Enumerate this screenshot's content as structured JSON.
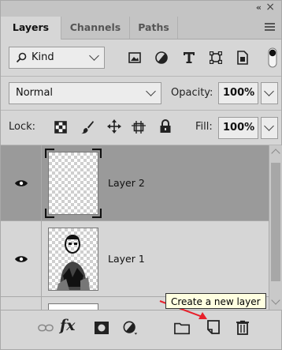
{
  "panel": {
    "collapse_glyph": "«",
    "close_glyph": "×"
  },
  "tabs": [
    {
      "label": "Layers",
      "active": true
    },
    {
      "label": "Channels",
      "active": false
    },
    {
      "label": "Paths",
      "active": false
    }
  ],
  "filter": {
    "kind_label": "Kind",
    "icons": [
      "image-filter-icon",
      "adjustment-filter-icon",
      "type-filter-icon",
      "shape-filter-icon",
      "smart-object-filter-icon",
      "filter-toggle-icon"
    ]
  },
  "blend": {
    "mode": "Normal",
    "opacity_label": "Opacity:",
    "opacity_value": "100%"
  },
  "lock": {
    "label": "Lock:",
    "icons": [
      "lock-transparent-pixels-icon",
      "lock-image-pixels-icon",
      "lock-position-icon",
      "lock-artboard-icon",
      "lock-all-icon"
    ],
    "fill_label": "Fill:",
    "fill_value": "100%"
  },
  "layers": [
    {
      "name": "Layer 2",
      "selected": true,
      "visible": true
    },
    {
      "name": "Layer 1",
      "selected": false,
      "visible": true
    },
    {
      "name": "",
      "selected": false,
      "visible": false
    }
  ],
  "toolbar": {
    "icons": [
      "link-layers-icon",
      "layer-style-fx-icon",
      "add-mask-icon",
      "new-adjustment-layer-icon",
      "new-group-icon",
      "create-new-layer-icon",
      "delete-layer-icon"
    ],
    "fx_label": "fx",
    "tooltip": "Create a new layer"
  },
  "colors": {
    "panel_bg": "#d6d6d6",
    "selected_row": "#9a9a9a",
    "tooltip_bg": "#ffffe1",
    "annotation_arrow": "#e8202a"
  }
}
